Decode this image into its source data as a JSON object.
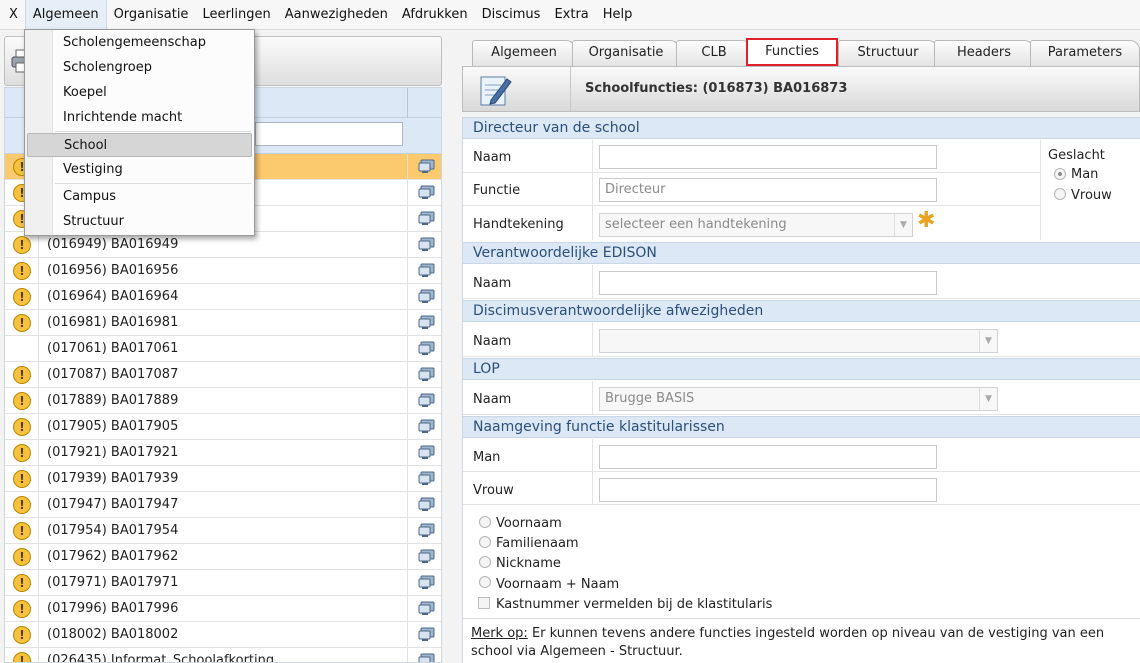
{
  "menubar": {
    "items": [
      "X",
      "Algemeen",
      "Organisatie",
      "Leerlingen",
      "Aanwezigheden",
      "Afdrukken",
      "Discimus",
      "Extra",
      "Help"
    ]
  },
  "dropdown": {
    "items": [
      "Scholengemeenschap",
      "Scholengroep",
      "Koepel",
      "Inrichtende macht",
      "School",
      "Vestiging",
      "Campus",
      "Structuur"
    ],
    "highlighted": "School"
  },
  "school_list": {
    "rows": [
      {
        "text": "",
        "warn": true,
        "selected": true
      },
      {
        "text": "",
        "warn": true
      },
      {
        "text": "",
        "warn": true
      },
      {
        "text": "(016949) BA016949",
        "warn": true
      },
      {
        "text": "(016956) BA016956",
        "warn": true
      },
      {
        "text": "(016964) BA016964",
        "warn": true
      },
      {
        "text": "(016981) BA016981",
        "warn": true
      },
      {
        "text": "(017061) BA017061",
        "warn": false
      },
      {
        "text": "(017087) BA017087",
        "warn": true
      },
      {
        "text": "(017889) BA017889",
        "warn": true
      },
      {
        "text": "(017905) BA017905",
        "warn": true
      },
      {
        "text": "(017921) BA017921",
        "warn": true
      },
      {
        "text": "(017939) BA017939",
        "warn": true
      },
      {
        "text": "(017947) BA017947",
        "warn": true
      },
      {
        "text": "(017954) BA017954",
        "warn": true
      },
      {
        "text": "(017962) BA017962",
        "warn": true
      },
      {
        "text": "(017971) BA017971",
        "warn": true
      },
      {
        "text": "(017996) BA017996",
        "warn": true
      },
      {
        "text": "(018002) BA018002",
        "warn": true
      },
      {
        "text": "(026435) Informat_Schoolafkorting",
        "warn": true
      }
    ]
  },
  "tabs": {
    "items": [
      "Algemeen",
      "Organisatie",
      "CLB",
      "Functies",
      "Structuur",
      "Headers",
      "Parameters"
    ],
    "active": "Functies"
  },
  "header": {
    "title": "Schoolfuncties: (016873) BA016873"
  },
  "form": {
    "directeur": {
      "section": "Directeur van de school",
      "naam_label": "Naam",
      "naam_value": "",
      "functie_label": "Functie",
      "functie_value": "Directeur",
      "handtekening_label": "Handtekening",
      "handtekening_placeholder": "selecteer een handtekening",
      "geslacht_label": "Geslacht",
      "man_label": "Man",
      "vrouw_label": "Vrouw"
    },
    "edison": {
      "section": "Verantwoordelijke EDISON",
      "naam_label": "Naam",
      "naam_value": ""
    },
    "discimus": {
      "section": "Discimusverantwoordelijke afwezigheden",
      "naam_label": "Naam",
      "naam_value": ""
    },
    "lop": {
      "section": "LOP",
      "naam_label": "Naam",
      "naam_value": "Brugge BASIS"
    },
    "klastitularissen": {
      "section": "Naamgeving functie klastitularissen",
      "man_label": "Man",
      "vrouw_label": "Vrouw",
      "options": [
        "Voornaam",
        "Familienaam",
        "Nickname",
        "Voornaam + Naam"
      ],
      "checkbox_label": "Kastnummer vermelden bij de klastitularis"
    },
    "note_prefix": "Merk op:",
    "note_text": " Er kunnen tevens andere functies ingesteld worden op niveau van de vestiging van een school via Algemeen - Structuur."
  }
}
